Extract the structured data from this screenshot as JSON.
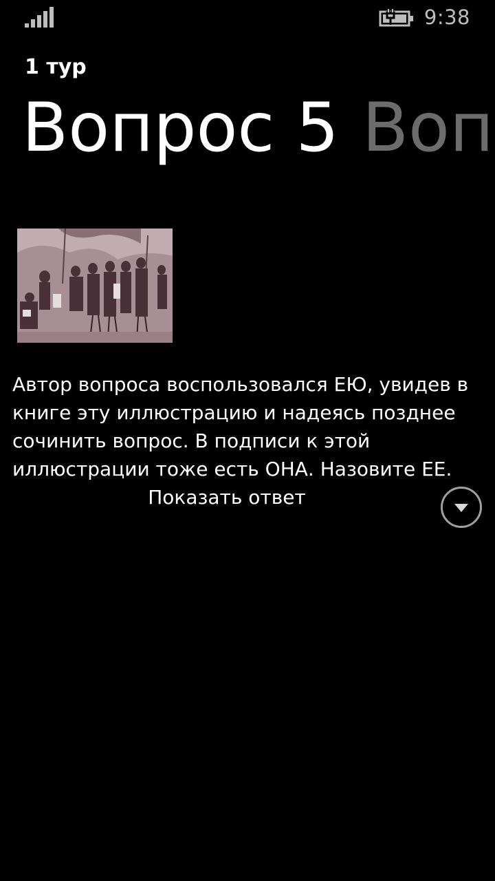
{
  "status_bar": {
    "signal_icon": "signal-strength-icon",
    "battery_icon": "battery-charging-icon",
    "time": "9:38"
  },
  "header": {
    "subtitle": "1 тур"
  },
  "pivot": {
    "active_title": "Вопрос 5",
    "next_title": "Вопр"
  },
  "question": {
    "image_alt": "engraving illustration",
    "text": "Автор вопроса воспользовался ЕЮ, увидев в книге эту иллюстрацию и надеясь позднее сочинить вопрос. В подписи к этой иллюстрации тоже есть ОНА. Назовите ЕЕ."
  },
  "actions": {
    "show_answer_label": "Показать ответ",
    "expand_icon": "chevron-down-circle-icon"
  },
  "colors": {
    "background": "#000000",
    "text": "#ffffff",
    "inactive_pivot": "#6c6c6c",
    "illustration_tint": "#a88f95"
  }
}
